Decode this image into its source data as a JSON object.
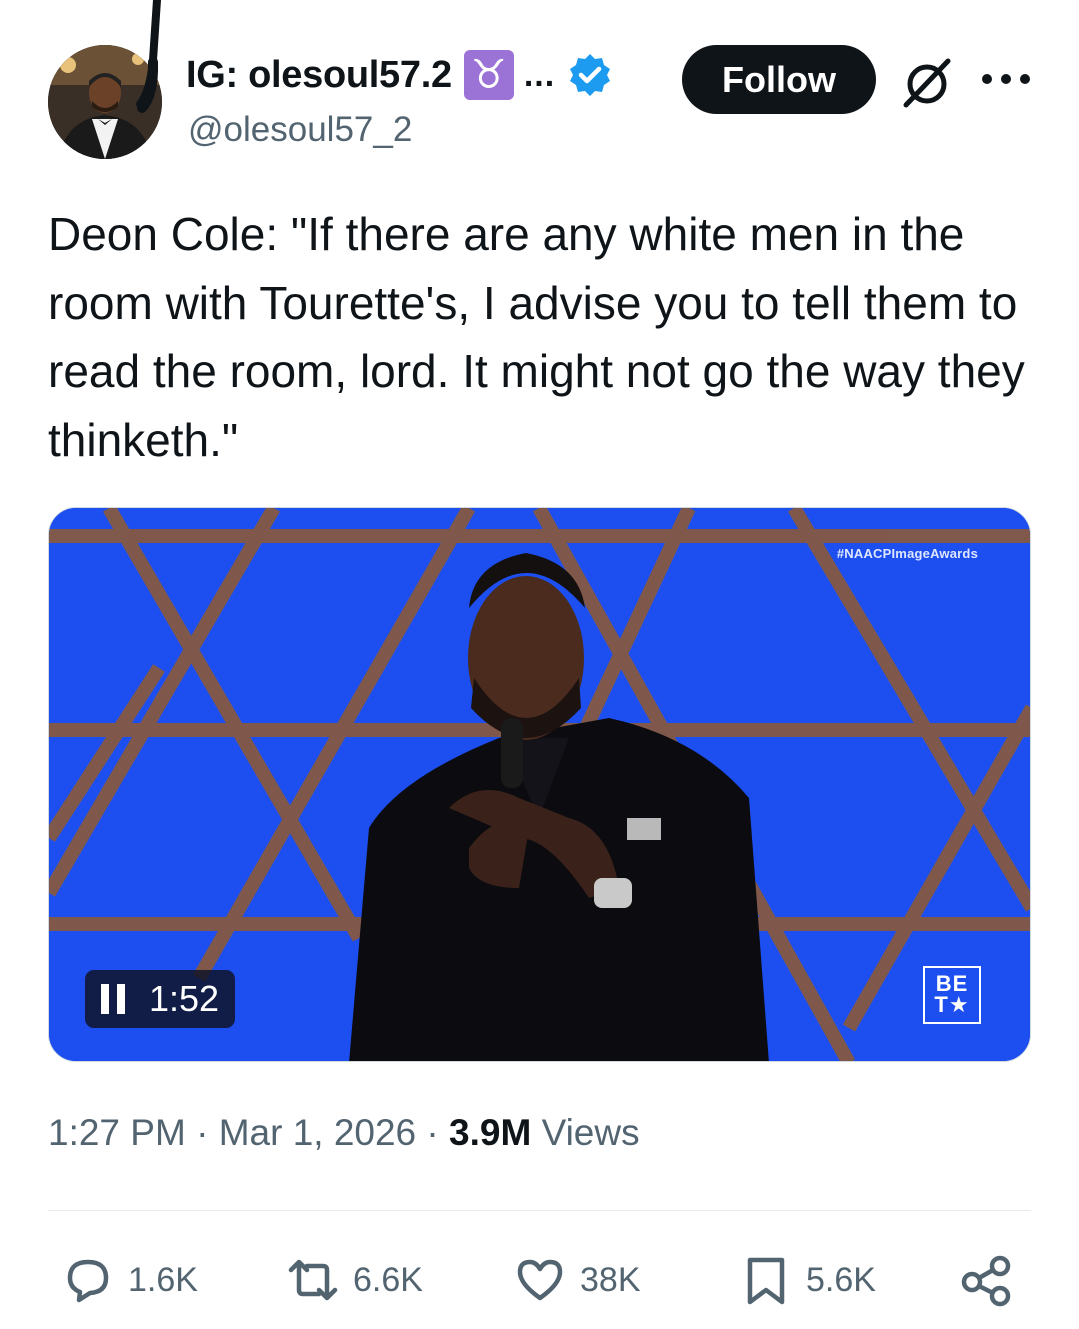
{
  "user": {
    "display_name": "IG: olesoul57.2",
    "zodiac_emoji": "♉",
    "name_truncation": "...",
    "handle": "@olesoul57_2",
    "verified": true
  },
  "header": {
    "follow_label": "Follow",
    "more_icon": "more-horizontal-icon",
    "grok_icon": "grok-icon"
  },
  "tweet": {
    "text": "Deon Cole: \"If there are any white men in the room with Tourette's, I advise you to tell them to read the room, lord. It might not go the way they thinketh.\""
  },
  "media": {
    "hashtag": "#NAACPImageAwards",
    "duration": "1:52",
    "state": "playing",
    "network_logo_line1": "BE",
    "network_logo_line2": "T★"
  },
  "meta": {
    "time": "1:27 PM",
    "separator": "·",
    "date": "Mar 1, 2026",
    "views_count": "3.9M",
    "views_label": "Views"
  },
  "actions": {
    "replies": "1.6K",
    "reposts": "6.6K",
    "likes": "38K",
    "bookmarks": "5.6K"
  },
  "colors": {
    "text_primary": "#0f1419",
    "text_secondary": "#536471",
    "verified_blue": "#1d9bf0",
    "zodiac_purple": "#9b73d6",
    "video_blue": "#1d4ff0"
  }
}
